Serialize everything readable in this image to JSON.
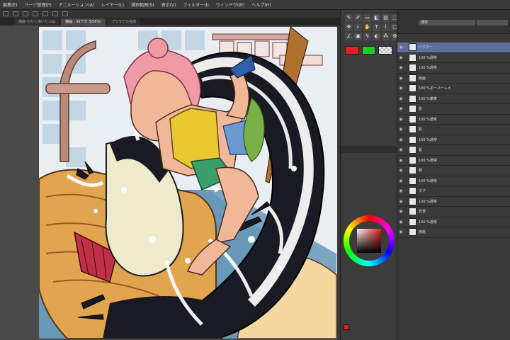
{
  "menu": [
    "編集(E)",
    "ページ管理(P)",
    "アニメーション(A)",
    "レイヤー(L)",
    "選択範囲(S)",
    "表示(V)",
    "フィルター(I)",
    "ウィンドウ(W)",
    "ヘルプ(H)"
  ],
  "tabs": [
    {
      "label": "描画-ちかく描いた.clip"
    },
    {
      "label": "描画 - 3dデカ 3(56%)"
    },
    {
      "label": "プラモデル完成"
    }
  ],
  "tool_icons": [
    "pen-icon",
    "brush-icon",
    "eraser-icon",
    "fill-icon",
    "gradient-icon",
    "select-icon",
    "move-icon",
    "zoom-icon",
    "hand-icon",
    "text-icon",
    "eyedropper-icon",
    "figure-icon",
    "ruler-icon",
    "frame-icon",
    "correct-icon",
    "blend-icon",
    "airbrush-icon",
    "deco-icon"
  ],
  "colors": {
    "fg": "#e02020",
    "bg": "#22cc22"
  },
  "layer_panel": {
    "blend_mode": "通常"
  },
  "layers": [
    {
      "name": "ベクター",
      "selected": true
    },
    {
      "name": "100 %通常",
      "selected": false
    },
    {
      "name": "100 %通常",
      "selected": false
    },
    {
      "name": "線画",
      "selected": false
    },
    {
      "name": "100 %オーバーレイ",
      "selected": false
    },
    {
      "name": "100 %乗算",
      "selected": false
    },
    {
      "name": "影",
      "selected": false
    },
    {
      "name": "100 %通常",
      "selected": false
    },
    {
      "name": "肌",
      "selected": false
    },
    {
      "name": "100 %通常",
      "selected": false
    },
    {
      "name": "髪",
      "selected": false
    },
    {
      "name": "100 %通常",
      "selected": false
    },
    {
      "name": "服",
      "selected": false
    },
    {
      "name": "100 %通常",
      "selected": false
    },
    {
      "name": "ラフ",
      "selected": false
    },
    {
      "name": "100 %通常",
      "selected": false
    },
    {
      "name": "背景",
      "selected": false
    },
    {
      "name": "100 %通常",
      "selected": false
    },
    {
      "name": "用紙",
      "selected": false
    }
  ]
}
